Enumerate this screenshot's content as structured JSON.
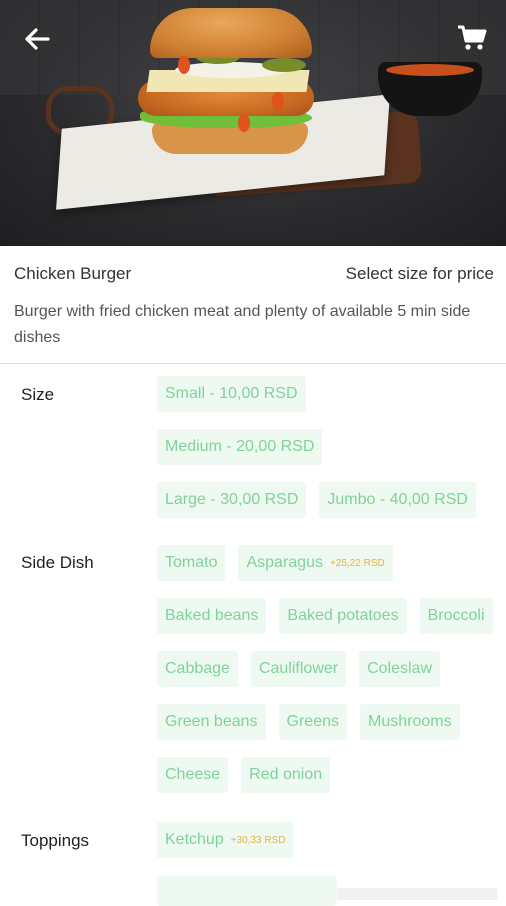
{
  "product": {
    "name": "Chicken Burger",
    "price_hint": "Select size for price",
    "description": "Burger with fried chicken meat and plenty of available 5 min side dishes"
  },
  "header": {
    "back_icon": "arrow-left-icon",
    "cart_icon": "shopping-cart-icon"
  },
  "options": {
    "size": {
      "label": "Size",
      "items": [
        {
          "label": "Small - 10,00 RSD"
        },
        {
          "label": "Medium - 20,00 RSD"
        },
        {
          "label": "Large - 30,00 RSD"
        },
        {
          "label": "Jumbo - 40,00 RSD"
        }
      ]
    },
    "side_dish": {
      "label": "Side Dish",
      "items": [
        {
          "label": "Tomato"
        },
        {
          "label": "Asparagus",
          "price": "+25,22 RSD"
        },
        {
          "label": "Baked beans"
        },
        {
          "label": "Baked potatoes"
        },
        {
          "label": "Broccoli"
        },
        {
          "label": "Cabbage"
        },
        {
          "label": "Cauliflower"
        },
        {
          "label": "Coleslaw"
        },
        {
          "label": "Green beans"
        },
        {
          "label": "Greens"
        },
        {
          "label": "Mushrooms"
        },
        {
          "label": "Cheese"
        },
        {
          "label": "Red onion"
        }
      ]
    },
    "toppings": {
      "label": "Toppings",
      "items": [
        {
          "label": "Ketchup",
          "price": "+30,33 RSD"
        }
      ]
    }
  },
  "colors": {
    "chip_bg": "#eef9f1",
    "chip_text": "#7fd39a",
    "price_text": "#e3b347"
  }
}
